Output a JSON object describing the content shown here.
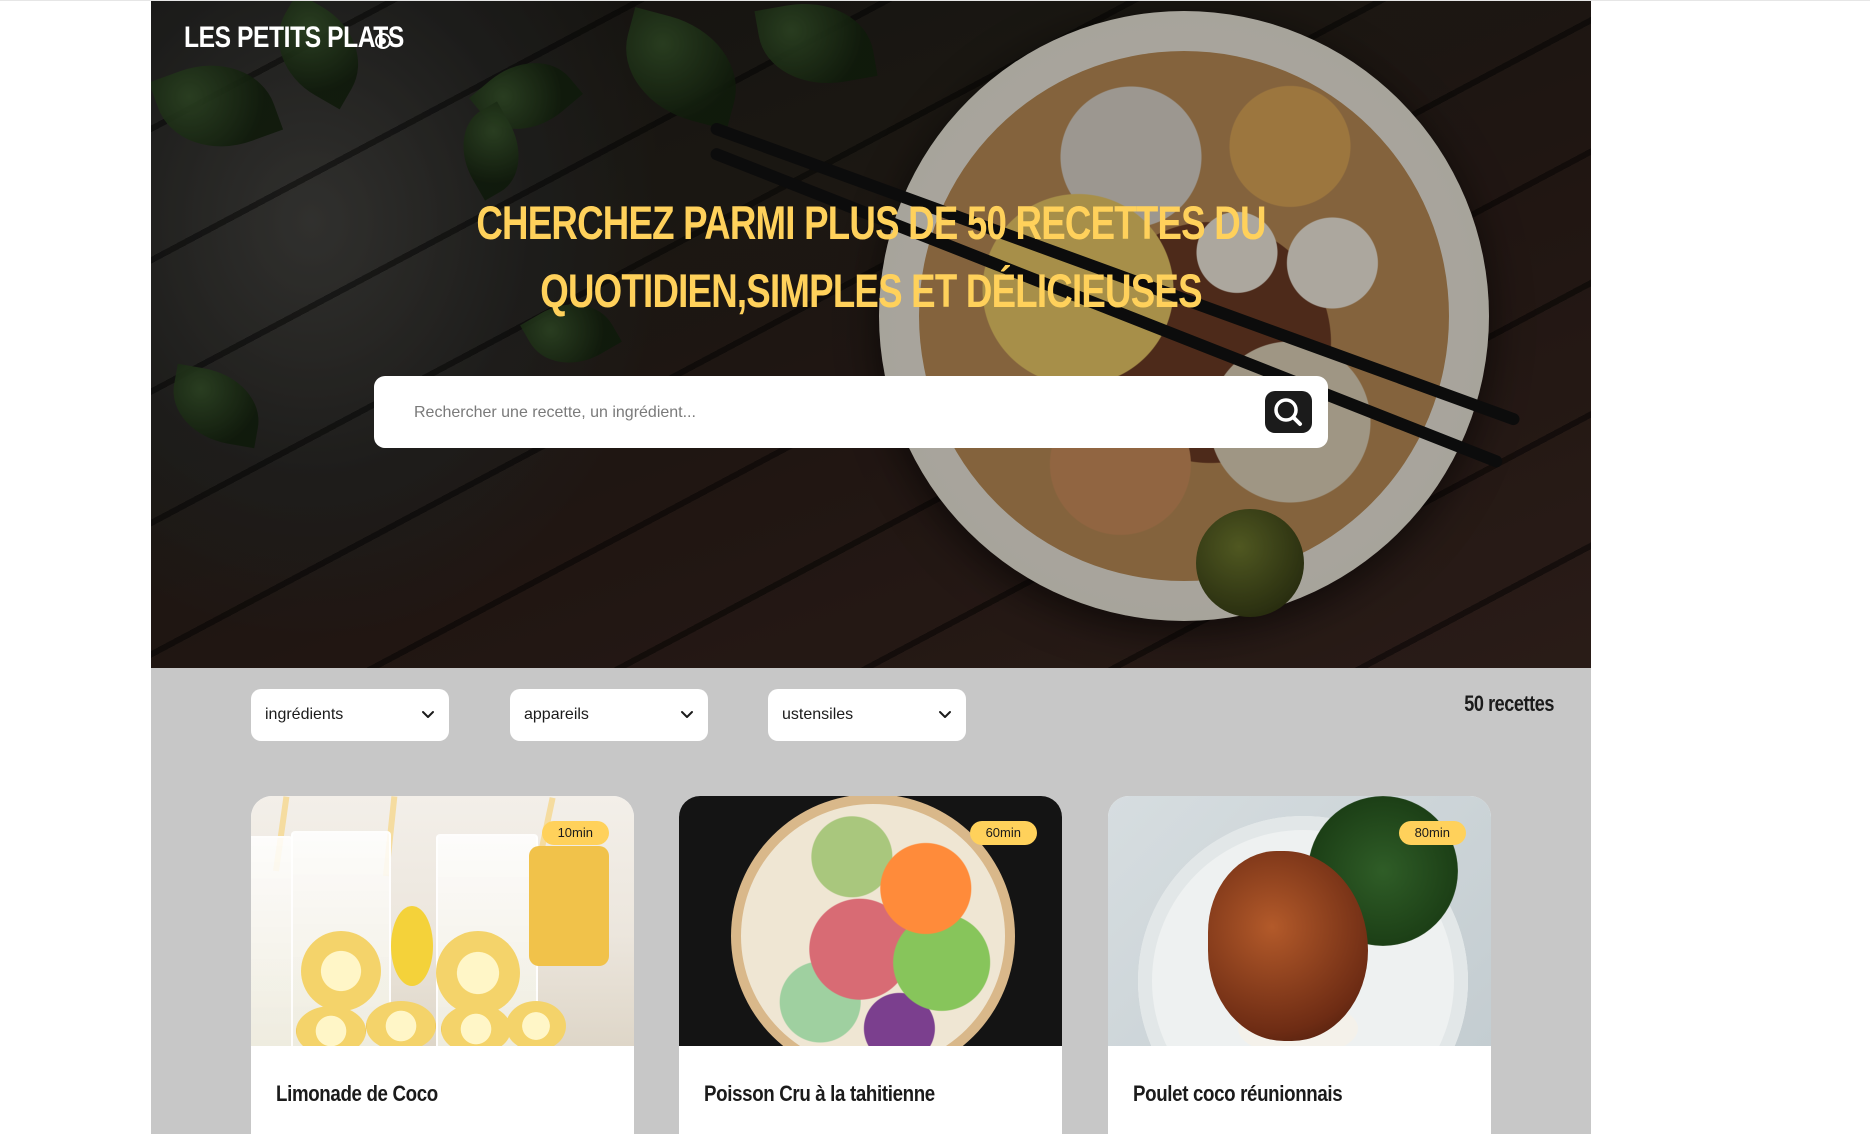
{
  "header": {
    "logo": "LES PETITS PLATS",
    "headline_line1": "CHERCHEZ PARMI PLUS DE 50 RECETTES DU",
    "headline_line2": "QUOTIDIEN,SIMPLES ET DÉLICIEUSES"
  },
  "search": {
    "placeholder": "Rechercher une recette, un ingrédient..."
  },
  "filters": [
    {
      "label": "ingrédients"
    },
    {
      "label": "appareils"
    },
    {
      "label": "ustensiles"
    }
  ],
  "results": {
    "count_label": "50 recettes"
  },
  "recipes": [
    {
      "title": "Limonade de Coco",
      "time": "10min"
    },
    {
      "title": "Poisson Cru à la tahitienne",
      "time": "60min"
    },
    {
      "title": "Poulet coco réunionnais",
      "time": "80min"
    }
  ],
  "colors": {
    "accent": "#ffd15b",
    "page_background": "#c7c7c7",
    "dark": "#1b1b1b"
  }
}
